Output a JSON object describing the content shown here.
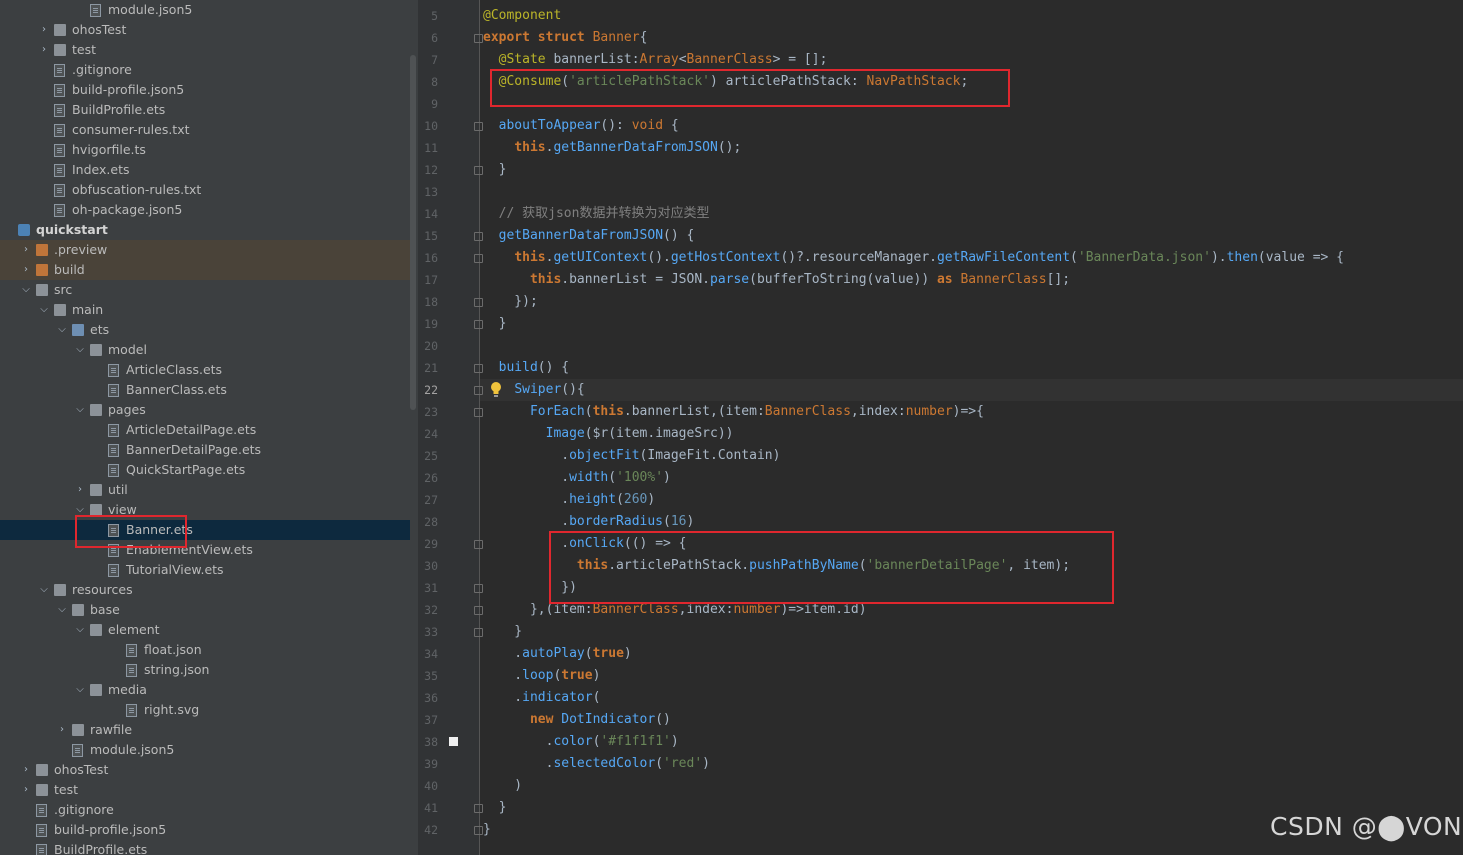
{
  "project_tree": {
    "rows": [
      {
        "label": "module.json5",
        "depth": 4,
        "icon": "json-file-icon"
      },
      {
        "label": "ohosTest",
        "depth": 2,
        "icon": "folder-icon",
        "arrow": "collapsed"
      },
      {
        "label": "test",
        "depth": 2,
        "icon": "folder-icon",
        "arrow": "collapsed"
      },
      {
        "label": ".gitignore",
        "depth": 2,
        "icon": "text-file-icon"
      },
      {
        "label": "build-profile.json5",
        "depth": 2,
        "icon": "json-file-icon"
      },
      {
        "label": "BuildProfile.ets",
        "depth": 2,
        "icon": "ets-file-icon"
      },
      {
        "label": "consumer-rules.txt",
        "depth": 2,
        "icon": "text-file-icon"
      },
      {
        "label": "hvigorfile.ts",
        "depth": 2,
        "icon": "ts-file-icon"
      },
      {
        "label": "Index.ets",
        "depth": 2,
        "icon": "ets-file-icon"
      },
      {
        "label": "obfuscation-rules.txt",
        "depth": 2,
        "icon": "text-file-icon"
      },
      {
        "label": "oh-package.json5",
        "depth": 2,
        "icon": "json-file-icon"
      },
      {
        "label": "quickstart",
        "depth": 0,
        "icon": "module-icon",
        "bold": true
      },
      {
        "label": ".preview",
        "depth": 1,
        "icon": "orange-folder-icon",
        "arrow": "collapsed",
        "highlight": "orange"
      },
      {
        "label": "build",
        "depth": 1,
        "icon": "orange-folder-icon",
        "arrow": "collapsed",
        "highlight": "orange"
      },
      {
        "label": "src",
        "depth": 1,
        "icon": "folder-icon",
        "arrow": "expanded"
      },
      {
        "label": "main",
        "depth": 2,
        "icon": "folder-icon",
        "arrow": "expanded"
      },
      {
        "label": "ets",
        "depth": 3,
        "icon": "blue-folder-icon",
        "arrow": "expanded"
      },
      {
        "label": "model",
        "depth": 4,
        "icon": "folder-icon",
        "arrow": "expanded"
      },
      {
        "label": "ArticleClass.ets",
        "depth": 5,
        "icon": "ets-file-icon"
      },
      {
        "label": "BannerClass.ets",
        "depth": 5,
        "icon": "ets-file-icon"
      },
      {
        "label": "pages",
        "depth": 4,
        "icon": "folder-icon",
        "arrow": "expanded"
      },
      {
        "label": "ArticleDetailPage.ets",
        "depth": 5,
        "icon": "ets-file-icon"
      },
      {
        "label": "BannerDetailPage.ets",
        "depth": 5,
        "icon": "ets-file-icon"
      },
      {
        "label": "QuickStartPage.ets",
        "depth": 5,
        "icon": "ets-file-icon"
      },
      {
        "label": "util",
        "depth": 4,
        "icon": "folder-icon",
        "arrow": "collapsed"
      },
      {
        "label": "view",
        "depth": 4,
        "icon": "folder-icon",
        "arrow": "expanded"
      },
      {
        "label": "Banner.ets",
        "depth": 5,
        "icon": "ets-file-icon",
        "selected": true
      },
      {
        "label": "EnablementView.ets",
        "depth": 5,
        "icon": "ets-file-icon"
      },
      {
        "label": "TutorialView.ets",
        "depth": 5,
        "icon": "ets-file-icon"
      },
      {
        "label": "resources",
        "depth": 2,
        "icon": "folder-icon",
        "arrow": "expanded"
      },
      {
        "label": "base",
        "depth": 3,
        "icon": "folder-icon",
        "arrow": "expanded"
      },
      {
        "label": "element",
        "depth": 4,
        "icon": "folder-icon",
        "arrow": "expanded"
      },
      {
        "label": "float.json",
        "depth": 6,
        "icon": "json-file-icon"
      },
      {
        "label": "string.json",
        "depth": 6,
        "icon": "json-file-icon"
      },
      {
        "label": "media",
        "depth": 4,
        "icon": "folder-icon",
        "arrow": "expanded"
      },
      {
        "label": "right.svg",
        "depth": 6,
        "icon": "svg-file-icon"
      },
      {
        "label": "rawfile",
        "depth": 3,
        "icon": "folder-icon",
        "arrow": "collapsed"
      },
      {
        "label": "module.json5",
        "depth": 3,
        "icon": "json-file-icon"
      },
      {
        "label": "ohosTest",
        "depth": 1,
        "icon": "folder-icon",
        "arrow": "collapsed"
      },
      {
        "label": "test",
        "depth": 1,
        "icon": "folder-icon",
        "arrow": "collapsed"
      },
      {
        "label": ".gitignore",
        "depth": 1,
        "icon": "text-file-icon"
      },
      {
        "label": "build-profile.json5",
        "depth": 1,
        "icon": "json-file-icon"
      },
      {
        "label": "BuildProfile.ets",
        "depth": 1,
        "icon": "ets-file-icon"
      }
    ]
  },
  "editor": {
    "current_line": 22,
    "lines": [
      {
        "n": "5",
        "tokens": [
          [
            "dec",
            "@Component"
          ]
        ]
      },
      {
        "n": "6",
        "tokens": [
          [
            "kw",
            "export "
          ],
          [
            "kw",
            "struct "
          ],
          [
            "type",
            "Banner"
          ],
          [
            "ident",
            "{"
          ]
        ]
      },
      {
        "n": "7",
        "tokens": [
          [
            "ident",
            "  "
          ],
          [
            "dec",
            "@State "
          ],
          [
            "ident",
            "bannerList:"
          ],
          [
            "type",
            "Array"
          ],
          [
            "ident",
            "<"
          ],
          [
            "type",
            "BannerClass"
          ],
          [
            "ident",
            "> = [];"
          ]
        ]
      },
      {
        "n": "8",
        "tokens": [
          [
            "ident",
            "  "
          ],
          [
            "dec",
            "@Consume"
          ],
          [
            "ident",
            "("
          ],
          [
            "str",
            "'articlePathStack'"
          ],
          [
            "ident",
            ") articlePathStack: "
          ],
          [
            "type",
            "NavPathStack"
          ],
          [
            "ident",
            ";"
          ]
        ]
      },
      {
        "n": "9",
        "tokens": []
      },
      {
        "n": "10",
        "tokens": [
          [
            "ident",
            "  "
          ],
          [
            "call",
            "aboutToAppear"
          ],
          [
            "ident",
            "(): "
          ],
          [
            "kw2",
            "void "
          ],
          [
            "ident",
            "{"
          ]
        ]
      },
      {
        "n": "11",
        "tokens": [
          [
            "ident",
            "    "
          ],
          [
            "kw",
            "this"
          ],
          [
            "ident",
            "."
          ],
          [
            "call",
            "getBannerDataFromJSON"
          ],
          [
            "ident",
            "();"
          ]
        ]
      },
      {
        "n": "12",
        "tokens": [
          [
            "ident",
            "  }"
          ]
        ]
      },
      {
        "n": "13",
        "tokens": []
      },
      {
        "n": "14",
        "tokens": [
          [
            "ident",
            "  "
          ],
          [
            "cm",
            "// 获取json数据并转换为对应类型"
          ]
        ]
      },
      {
        "n": "15",
        "tokens": [
          [
            "ident",
            "  "
          ],
          [
            "call",
            "getBannerDataFromJSON"
          ],
          [
            "ident",
            "() {"
          ]
        ]
      },
      {
        "n": "16",
        "tokens": [
          [
            "ident",
            "    "
          ],
          [
            "kw",
            "this"
          ],
          [
            "ident",
            "."
          ],
          [
            "call",
            "getUIContext"
          ],
          [
            "ident",
            "()."
          ],
          [
            "call",
            "getHostContext"
          ],
          [
            "ident",
            "()?.resourceManager."
          ],
          [
            "call",
            "getRawFileContent"
          ],
          [
            "ident",
            "("
          ],
          [
            "str",
            "'BannerData.json'"
          ],
          [
            "ident",
            ")."
          ],
          [
            "call",
            "then"
          ],
          [
            "ident",
            "(value => {"
          ]
        ]
      },
      {
        "n": "17",
        "tokens": [
          [
            "ident",
            "      "
          ],
          [
            "kw",
            "this"
          ],
          [
            "ident",
            ".bannerList = JSON."
          ],
          [
            "call",
            "parse"
          ],
          [
            "ident",
            "(bufferToString(value)) "
          ],
          [
            "kw",
            "as "
          ],
          [
            "type",
            "BannerClass"
          ],
          [
            "ident",
            "[];"
          ]
        ]
      },
      {
        "n": "18",
        "tokens": [
          [
            "ident",
            "    });"
          ]
        ]
      },
      {
        "n": "19",
        "tokens": [
          [
            "ident",
            "  }"
          ]
        ]
      },
      {
        "n": "20",
        "tokens": []
      },
      {
        "n": "21",
        "tokens": [
          [
            "ident",
            "  "
          ],
          [
            "call",
            "build"
          ],
          [
            "ident",
            "() {"
          ]
        ]
      },
      {
        "n": "22",
        "tokens": [
          [
            "ident",
            "    "
          ],
          [
            "call",
            "Swiper"
          ],
          [
            "ident",
            "(){"
          ]
        ]
      },
      {
        "n": "23",
        "tokens": [
          [
            "ident",
            "      "
          ],
          [
            "call",
            "ForEach"
          ],
          [
            "ident",
            "("
          ],
          [
            "kw",
            "this"
          ],
          [
            "ident",
            ".bannerList,(item:"
          ],
          [
            "type",
            "BannerClass"
          ],
          [
            "ident",
            ",index:"
          ],
          [
            "type",
            "number"
          ],
          [
            "ident",
            ")=>{"
          ]
        ]
      },
      {
        "n": "24",
        "tokens": [
          [
            "ident",
            "        "
          ],
          [
            "call",
            "Image"
          ],
          [
            "ident",
            "($r(item.imageSrc))"
          ]
        ]
      },
      {
        "n": "25",
        "tokens": [
          [
            "ident",
            "          ."
          ],
          [
            "call",
            "objectFit"
          ],
          [
            "ident",
            "(ImageFit.Contain)"
          ]
        ]
      },
      {
        "n": "26",
        "tokens": [
          [
            "ident",
            "          ."
          ],
          [
            "call",
            "width"
          ],
          [
            "ident",
            "("
          ],
          [
            "str",
            "'100%'"
          ],
          [
            "ident",
            ")"
          ]
        ]
      },
      {
        "n": "27",
        "tokens": [
          [
            "ident",
            "          ."
          ],
          [
            "call",
            "height"
          ],
          [
            "ident",
            "("
          ],
          [
            "num",
            "260"
          ],
          [
            "ident",
            ")"
          ]
        ]
      },
      {
        "n": "28",
        "tokens": [
          [
            "ident",
            "          ."
          ],
          [
            "call",
            "borderRadius"
          ],
          [
            "ident",
            "("
          ],
          [
            "num",
            "16"
          ],
          [
            "ident",
            ")"
          ]
        ]
      },
      {
        "n": "29",
        "tokens": [
          [
            "ident",
            "          ."
          ],
          [
            "call",
            "onClick"
          ],
          [
            "ident",
            "(() => {"
          ]
        ]
      },
      {
        "n": "30",
        "tokens": [
          [
            "ident",
            "            "
          ],
          [
            "kw",
            "this"
          ],
          [
            "ident",
            ".articlePathStack."
          ],
          [
            "call",
            "pushPathByName"
          ],
          [
            "ident",
            "("
          ],
          [
            "str",
            "'bannerDetailPage'"
          ],
          [
            "ident",
            ", item);"
          ]
        ]
      },
      {
        "n": "31",
        "tokens": [
          [
            "ident",
            "          })"
          ]
        ]
      },
      {
        "n": "32",
        "tokens": [
          [
            "ident",
            "      },(item:"
          ],
          [
            "type",
            "BannerClass"
          ],
          [
            "ident",
            ",index:"
          ],
          [
            "type",
            "number"
          ],
          [
            "ident",
            ")=>item.id)"
          ]
        ]
      },
      {
        "n": "33",
        "tokens": [
          [
            "ident",
            "    }"
          ]
        ]
      },
      {
        "n": "34",
        "tokens": [
          [
            "ident",
            "    ."
          ],
          [
            "call",
            "autoPlay"
          ],
          [
            "ident",
            "("
          ],
          [
            "kw",
            "true"
          ],
          [
            "ident",
            ")"
          ]
        ]
      },
      {
        "n": "35",
        "tokens": [
          [
            "ident",
            "    ."
          ],
          [
            "call",
            "loop"
          ],
          [
            "ident",
            "("
          ],
          [
            "kw",
            "true"
          ],
          [
            "ident",
            ")"
          ]
        ]
      },
      {
        "n": "36",
        "tokens": [
          [
            "ident",
            "    ."
          ],
          [
            "call",
            "indicator"
          ],
          [
            "ident",
            "("
          ]
        ]
      },
      {
        "n": "37",
        "tokens": [
          [
            "ident",
            "      "
          ],
          [
            "kw",
            "new "
          ],
          [
            "call",
            "DotIndicator"
          ],
          [
            "ident",
            "()"
          ]
        ]
      },
      {
        "n": "38",
        "tokens": [
          [
            "ident",
            "        ."
          ],
          [
            "call",
            "color"
          ],
          [
            "ident",
            "("
          ],
          [
            "str",
            "'#f1f1f1'"
          ],
          [
            "ident",
            ")"
          ]
        ]
      },
      {
        "n": "39",
        "tokens": [
          [
            "ident",
            "        ."
          ],
          [
            "call",
            "selectedColor"
          ],
          [
            "ident",
            "("
          ],
          [
            "str",
            "'red'"
          ],
          [
            "ident",
            ")"
          ]
        ]
      },
      {
        "n": "40",
        "tokens": [
          [
            "ident",
            "    )"
          ]
        ]
      },
      {
        "n": "41",
        "tokens": [
          [
            "ident",
            "  }"
          ]
        ]
      },
      {
        "n": "42",
        "tokens": [
          [
            "ident",
            "}"
          ]
        ]
      }
    ]
  },
  "watermark": "CSDN @⬤VON",
  "colors": {
    "highlight_box": "#e0272e",
    "selected_row": "#0d293e"
  }
}
